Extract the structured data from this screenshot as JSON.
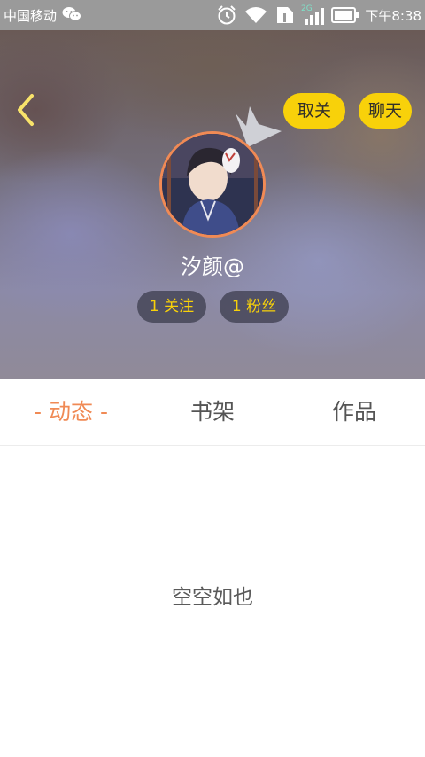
{
  "status_bar": {
    "carrier": "中国移动",
    "network": "2G",
    "time": "下午8:38"
  },
  "header": {
    "unfollow_label": "取关",
    "chat_label": "聊天",
    "nickname": "汐颜@",
    "following_label": "1 关注",
    "fans_label": "1 粉丝"
  },
  "tabs": [
    {
      "label": "- 动态 -",
      "active": true
    },
    {
      "label": "书架",
      "active": false
    },
    {
      "label": "作品",
      "active": false
    }
  ],
  "content": {
    "empty_message": "空空如也"
  },
  "colors": {
    "accent": "#f08a55",
    "button_yellow": "#f8d10a",
    "status_bar": "#9a9a9a"
  }
}
